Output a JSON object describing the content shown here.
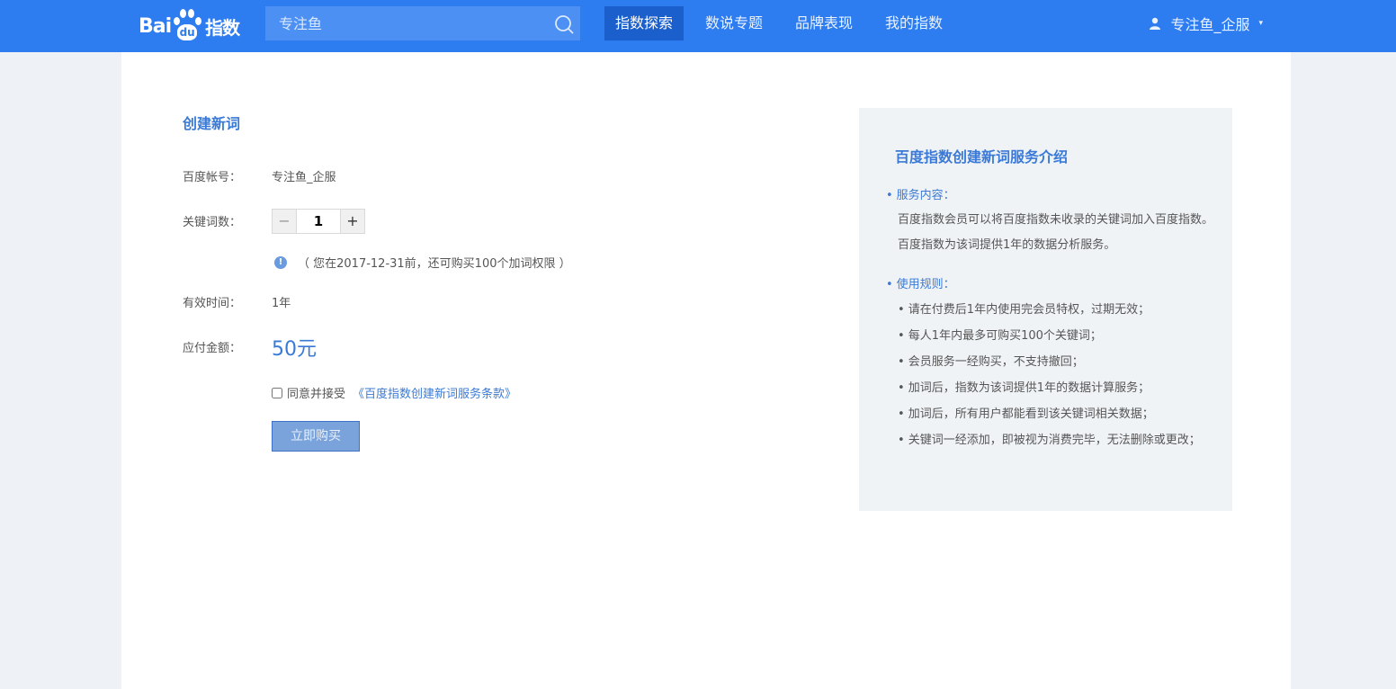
{
  "header": {
    "logo": {
      "bai": "Bai",
      "du": "du",
      "zhishu": "指数"
    },
    "search": {
      "placeholder": "专注鱼",
      "icon": "search-icon"
    },
    "nav": [
      {
        "label": "指数探索",
        "active": true
      },
      {
        "label": "数说专题",
        "active": false
      },
      {
        "label": "品牌表现",
        "active": false
      },
      {
        "label": "我的指数",
        "active": false
      }
    ],
    "user": {
      "name": "专注鱼_企服",
      "caret": "▾"
    }
  },
  "form": {
    "title": "创建新词",
    "account_label": "百度帐号：",
    "account_value": "专注鱼_企服",
    "keyword_count_label": "关键词数：",
    "keyword_count": "1",
    "minus": "−",
    "plus": "+",
    "info_icon": "!",
    "notice": "（ 您在2017-12-31前，还可购买100个加词权限 ）",
    "validity_label": "有效时间：",
    "validity_value": "1年",
    "amount_label": "应付金额：",
    "amount_value": "50元",
    "agree_text": "同意并接受",
    "terms_link": "《百度指数创建新词服务条款》",
    "buy_button": "立即购买"
  },
  "panel": {
    "title": "百度指数创建新词服务介绍",
    "bullet": "•",
    "service_heading": "服务内容：",
    "service_text": "百度指数会员可以将百度指数未收录的关键词加入百度指数。百度指数为该词提供1年的数据分析服务。",
    "rules_heading": "使用规则：",
    "rules": [
      "• 请在付费后1年内使用完会员特权，过期无效；",
      "• 每人1年内最多可购买100个关键词；",
      "• 会员服务一经购买，不支持撤回；",
      "• 加词后，指数为该词提供1年的数据计算服务；",
      "• 加词后，所有用户都能看到该关键词相关数据；",
      "• 关键词一经添加，即被视为消费完毕，无法删除或更改；"
    ]
  },
  "colors": {
    "topbar": "#2d7cf0",
    "accent": "#3a7ad6",
    "panel_bg": "#f0f3f6"
  }
}
